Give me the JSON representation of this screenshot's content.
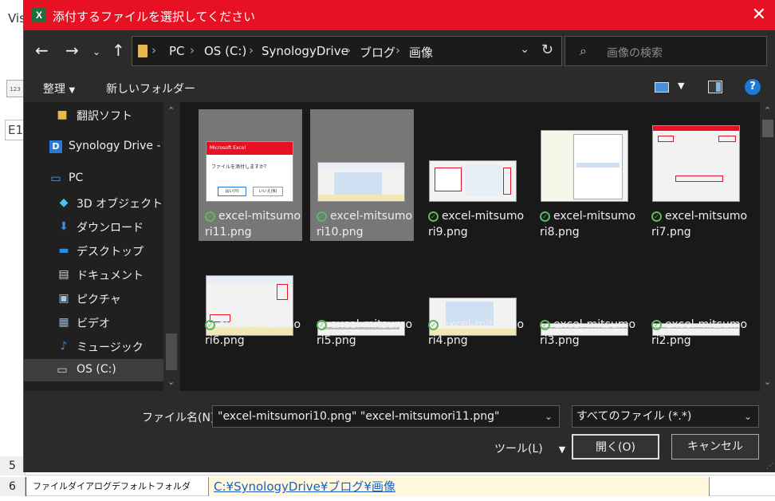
{
  "background": {
    "vis_text": "Vis",
    "e1_text": "E1",
    "row5_num": "5",
    "row6_num": "6",
    "row6_label": "ファイルダイアログデフォルトフォルダ",
    "row6_path": "C:¥SynologyDrive¥ブログ¥画像"
  },
  "dialog": {
    "title": "添付するファイルを選択してください",
    "accent_color": "#e81123"
  },
  "nav": {
    "breadcrumb": [
      "PC",
      "OS (C:)",
      "SynologyDrive",
      "ブログ",
      "画像"
    ],
    "search_placeholder": "画像の検索"
  },
  "toolbar": {
    "organize": "整理",
    "new_folder": "新しいフォルダー"
  },
  "sidebar": {
    "items": [
      {
        "label": "翻訳ソフト",
        "icon": "folder-sync-icon"
      },
      {
        "label": "Synology Drive - D",
        "icon": "synology-drive-icon"
      },
      {
        "label": "PC",
        "icon": "pc-icon"
      },
      {
        "label": "3D オブジェクト",
        "icon": "3d-objects-icon"
      },
      {
        "label": "ダウンロード",
        "icon": "download-icon"
      },
      {
        "label": "デスクトップ",
        "icon": "desktop-icon"
      },
      {
        "label": "ドキュメント",
        "icon": "documents-icon"
      },
      {
        "label": "ピクチャ",
        "icon": "pictures-icon"
      },
      {
        "label": "ビデオ",
        "icon": "videos-icon"
      },
      {
        "label": "ミュージック",
        "icon": "music-icon"
      },
      {
        "label": "OS (C:)",
        "icon": "drive-icon",
        "selected": true
      }
    ]
  },
  "files": [
    {
      "line1": "excel-mitsumo",
      "line2": "ri11.png",
      "selected": true
    },
    {
      "line1": "excel-mitsumo",
      "line2": "ri10.png",
      "selected": true
    },
    {
      "line1": "excel-mitsumo",
      "line2": "ri9.png",
      "selected": false
    },
    {
      "line1": "excel-mitsumo",
      "line2": "ri8.png",
      "selected": false
    },
    {
      "line1": "excel-mitsumo",
      "line2": "ri7.png",
      "selected": false
    },
    {
      "line1": "excel-mitsumo",
      "line2": "ri6.png",
      "selected": false
    },
    {
      "line1": "excel-mitsumo",
      "line2": "ri5.png",
      "selected": false
    },
    {
      "line1": "excel-mitsumo",
      "line2": "ri4.png",
      "selected": false
    },
    {
      "line1": "excel-mitsumo",
      "line2": "ri3.png",
      "selected": false
    },
    {
      "line1": "excel-mitsumo",
      "line2": "ri2.png",
      "selected": false
    }
  ],
  "thumb_text": {
    "msgbox_title": "Microsoft Excel",
    "msgbox_question": "ファイルを添付しますか？",
    "yes": "はい(Y)",
    "no": "いいえ(N)"
  },
  "footer": {
    "filename_label": "ファイル名(N):",
    "filename_value": "\"excel-mitsumori10.png\" \"excel-mitsumori11.png\"",
    "filetype_value": "すべてのファイル (*.*)",
    "tools_label": "ツール(L)",
    "open_label": "開く(O)",
    "cancel_label": "キャンセル"
  }
}
